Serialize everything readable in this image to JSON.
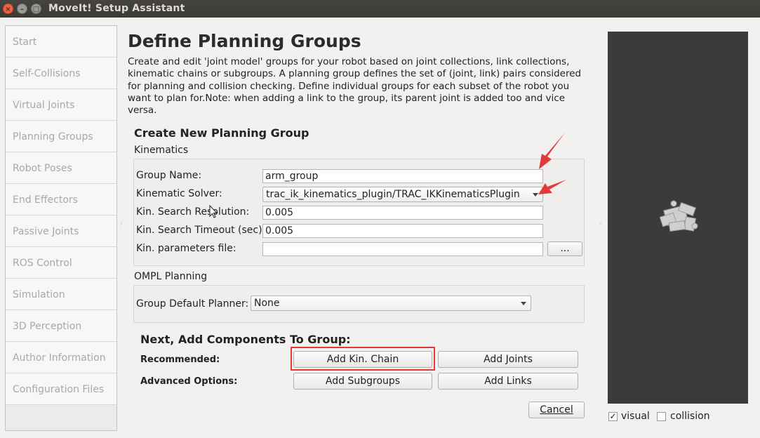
{
  "window": {
    "title": "MoveIt! Setup Assistant"
  },
  "sidebar": {
    "items": [
      {
        "label": "Start"
      },
      {
        "label": "Self-Collisions"
      },
      {
        "label": "Virtual Joints"
      },
      {
        "label": "Planning Groups"
      },
      {
        "label": "Robot Poses"
      },
      {
        "label": "End Effectors"
      },
      {
        "label": "Passive Joints"
      },
      {
        "label": "ROS Control"
      },
      {
        "label": "Simulation"
      },
      {
        "label": "3D Perception"
      },
      {
        "label": "Author Information"
      },
      {
        "label": "Configuration Files"
      }
    ]
  },
  "page": {
    "title": "Define Planning Groups",
    "description": "Create and edit 'joint model' groups for your robot based on joint collections, link collections, kinematic chains or subgroups. A planning group defines the set of (joint, link) pairs considered for planning and collision checking. Define individual groups for each subset of the robot you want to plan for.Note: when adding a link to the group, its parent joint is added too and vice versa."
  },
  "create": {
    "title": "Create New Planning Group",
    "kinematics_label": "Kinematics",
    "group_name_label": "Group Name:",
    "group_name_value": "arm_group",
    "solver_label": "Kinematic Solver:",
    "solver_value": "trac_ik_kinematics_plugin/TRAC_IKKinematicsPlugin",
    "resolution_label": "Kin. Search Resolution:",
    "resolution_value": "0.005",
    "timeout_label": "Kin. Search Timeout (sec):",
    "timeout_value": "0.005",
    "params_label": "Kin. parameters file:",
    "params_value": "",
    "browse_label": "...",
    "ompl_label": "OMPL Planning",
    "planner_label": "Group Default Planner:",
    "planner_value": "None"
  },
  "components": {
    "title": "Next, Add Components To Group:",
    "recommended_label": "Recommended:",
    "advanced_label": "Advanced Options:",
    "add_chain": "Add Kin. Chain",
    "add_joints": "Add Joints",
    "add_subgroups": "Add Subgroups",
    "add_links": "Add Links",
    "cancel": "Cancel"
  },
  "viewer": {
    "visual_label": "visual",
    "visual_checked": true,
    "collision_label": "collision",
    "collision_checked": false
  },
  "annotations": {
    "highlight_color": "#e03a3a"
  }
}
